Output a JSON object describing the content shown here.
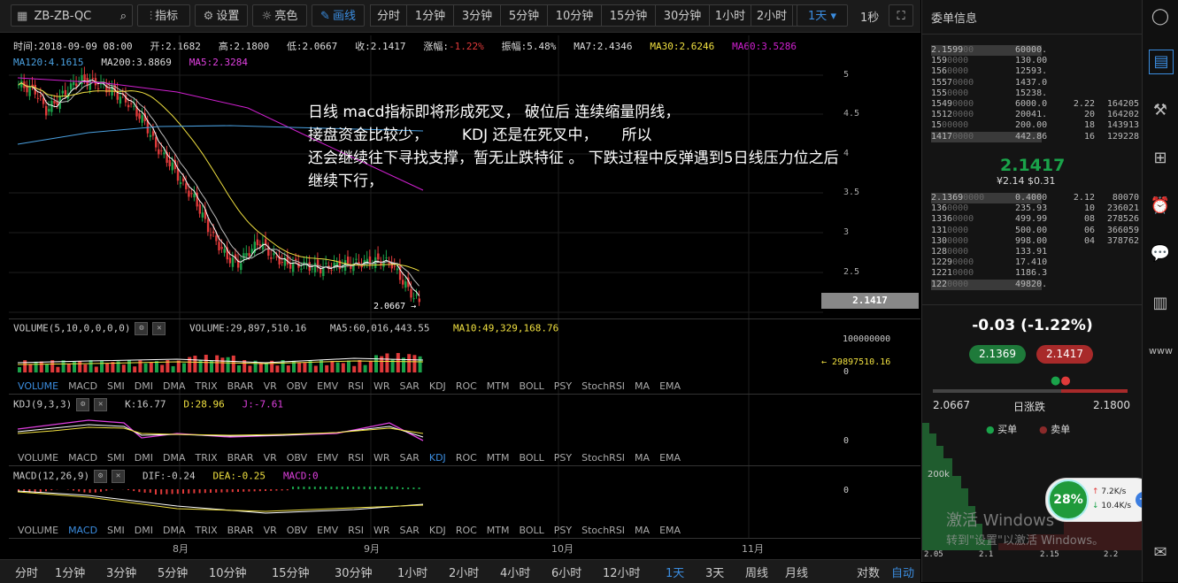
{
  "toolbar": {
    "symbol": "ZB-ZB-QC",
    "indicator": "指标",
    "settings": "设置",
    "theme": "亮色",
    "draw": "画线",
    "periods": [
      "分时",
      "1分钟",
      "3分钟",
      "5分钟",
      "10分钟",
      "15分钟",
      "30分钟",
      "1小时",
      "2小时",
      "4小时"
    ],
    "period_selected": "1天",
    "second": "1秒"
  },
  "info": {
    "time": "时间:2018-09-09 08:00",
    "open": "开:2.1682",
    "high": "高:2.1800",
    "low": "低:2.0667",
    "close": "收:2.1417",
    "change_label": "涨幅:",
    "change_value": "-1.22%",
    "amplitude": "振幅:5.48%",
    "ma7": "MA7:2.4346",
    "ma30": "MA30:2.6246",
    "ma60": "MA60:3.5286",
    "ma120": "MA120:4.1615",
    "ma200": "MA200:3.8869",
    "ma5": "MA5:2.3284"
  },
  "annotation": {
    "line1": "日线 macd指标即将形成死叉， 破位后 连续缩量阴线，",
    "line2": "接盘资金比较少，       KDJ 还是在死叉中，     所以",
    "line3": "还会继续往下寻找支撑，暂无止跌特征 。 下跌过程中反弹遇到5日线压力位之后",
    "line4": "继续下行，"
  },
  "price_axis": [
    "5",
    "4.5",
    "4",
    "3.5",
    "3",
    "2.5"
  ],
  "current_price": "2.1417",
  "low_marker": "2.0667 →",
  "volume": {
    "label": "VOLUME(5,10,0,0,0,0)",
    "value": "VOLUME:29,897,510.16",
    "ma5": "MA5:60,016,443.55",
    "ma10": "MA10:49,329,168.76",
    "axis_top": "100000000",
    "axis_zero": "0",
    "marker": "← 29897510.16"
  },
  "ind_tabs": [
    "VOLUME",
    "MACD",
    "SMI",
    "DMI",
    "DMA",
    "TRIX",
    "BRAR",
    "VR",
    "OBV",
    "EMV",
    "RSI",
    "WR",
    "SAR",
    "KDJ",
    "ROC",
    "MTM",
    "BOLL",
    "PSY",
    "StochRSI",
    "MA",
    "EMA"
  ],
  "kdj": {
    "label": "KDJ(9,3,3)",
    "k": "K:16.77",
    "d": "D:28.96",
    "j": "J:-7.61",
    "axis_zero": "0"
  },
  "macd": {
    "label": "MACD(12,26,9)",
    "dif": "DIF:-0.24",
    "dea": "DEA:-0.25",
    "macd": "MACD:0",
    "axis_zero": "0"
  },
  "time_axis": [
    "8月",
    "9月",
    "10月",
    "11月"
  ],
  "bottombar": {
    "periods": [
      "分时",
      "1分钟",
      "3分钟",
      "5分钟",
      "10分钟",
      "15分钟",
      "30分钟",
      "1小时",
      "2小时",
      "4小时",
      "6小时",
      "12小时",
      "1天",
      "3天",
      "周线",
      "月线"
    ],
    "selected": "1天",
    "log": "对数",
    "auto": "自动"
  },
  "orderbook": {
    "title": "委单信息",
    "asks": [
      {
        "p": "2.1599",
        "pz": "00",
        "q": "60000.",
        "c": "",
        "t": ""
      },
      {
        "p": "159",
        "pz": "0000",
        "q": "130.00",
        "c": "",
        "t": ""
      },
      {
        "p": "156",
        "pz": "0000",
        "q": "12593.",
        "c": "",
        "t": ""
      },
      {
        "p": "1557",
        "pz": "0000",
        "q": "1437.0",
        "c": "",
        "t": ""
      },
      {
        "p": "155",
        "pz": "0000",
        "q": "15238.",
        "c": "",
        "t": ""
      },
      {
        "p": "1549",
        "pz": "0000",
        "q": "6000.0",
        "c": "2.22",
        "t": "164205"
      },
      {
        "p": "1512",
        "pz": "0000",
        "q": "20041.",
        "c": "20",
        "t": "164202"
      },
      {
        "p": "15",
        "pz": "00000",
        "q": "200.00",
        "c": "18",
        "t": "143913"
      },
      {
        "p": "1417",
        "pz": "0000",
        "q": "442.86",
        "c": "16",
        "t": "129228"
      }
    ],
    "last_price": "2.1417",
    "last_sub1": "¥2.14",
    "last_sub2": "$0.31",
    "bids": [
      {
        "p": "2.1369",
        "pz": "0000",
        "q": "0.4000",
        "c": "2.12",
        "t": "80070"
      },
      {
        "p": "136",
        "pz": "0000",
        "q": "235.93",
        "c": "10",
        "t": "236021"
      },
      {
        "p": "1336",
        "pz": "0000",
        "q": "499.99",
        "c": "08",
        "t": "278526"
      },
      {
        "p": "131",
        "pz": "0000",
        "q": "500.00",
        "c": "06",
        "t": "366059"
      },
      {
        "p": "130",
        "pz": "0000",
        "q": "998.00",
        "c": "04",
        "t": "378762"
      },
      {
        "p": "128",
        "pz": "0000",
        "q": "133.91",
        "c": "",
        "t": ""
      },
      {
        "p": "1229",
        "pz": "0000",
        "q": "17.410",
        "c": "",
        "t": ""
      },
      {
        "p": "1221",
        "pz": "0000",
        "q": "1186.3",
        "c": "",
        "t": ""
      },
      {
        "p": "122",
        "pz": "0000",
        "q": "49820.",
        "c": "",
        "t": ""
      }
    ],
    "change": "-0.03 (-1.22%)",
    "bid_btn": "2.1369",
    "ask_btn": "2.1417",
    "range_low": "2.0667",
    "range_label": "日涨跌",
    "range_high": "2.1800",
    "legend_buy": "买单",
    "legend_sell": "卖单",
    "depth_label": "200k",
    "depth_axis": [
      "2.05",
      "2.1",
      "2.15",
      "2.2"
    ]
  },
  "widget": {
    "percent": "28%",
    "up": "7.2K/s",
    "down": "10.4K/s"
  },
  "watermark": {
    "line1": "激活 Windows",
    "line2": "转到\"设置\"以激活 Windows。"
  },
  "colors": {
    "up": "#1aa34a",
    "down": "#e03a3a",
    "accent": "#3b8de0",
    "ma5": "#ffffff",
    "ma30": "#f0e040",
    "ma60": "#d020d0",
    "ma120": "#4aa0e0"
  }
}
